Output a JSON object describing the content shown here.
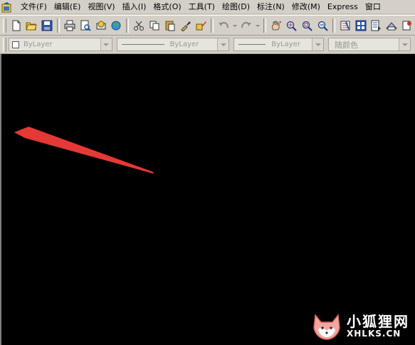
{
  "menu": {
    "items": [
      "文件(F)",
      "编辑(E)",
      "视图(V)",
      "插入(I)",
      "格式(O)",
      "工具(T)",
      "绘图(D)",
      "标注(N)",
      "修改(M)",
      "Express",
      "窗口"
    ]
  },
  "properties": {
    "color": "ByLayer",
    "linetype": "ByLayer",
    "lineweight": "ByLayer",
    "plotstyle": "随颜色"
  },
  "watermark": {
    "cn": "小狐狸网",
    "en": "XHLKS.CN"
  },
  "annotation": {
    "arrow_color": "#e53935"
  }
}
